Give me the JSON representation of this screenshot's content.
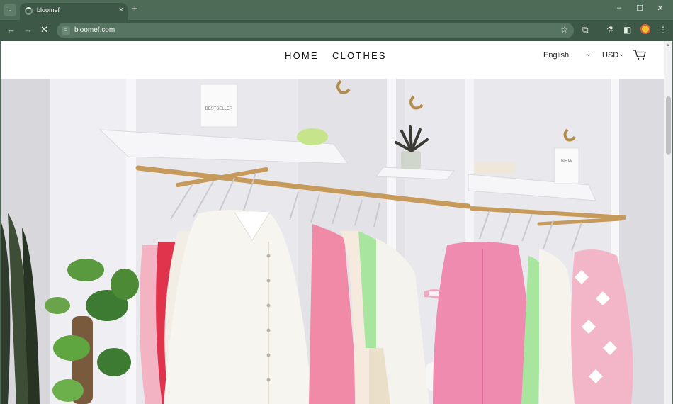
{
  "browser": {
    "tab_title": "bloomef",
    "tab_close": "×",
    "new_tab": "+",
    "url": "bloomef.com",
    "window_controls": {
      "minimize": "–",
      "maximize": "☐",
      "close": "✕"
    },
    "icons": [
      "tab-search-icon",
      "loading-spinner-icon",
      "back-icon",
      "forward-icon",
      "stop-icon",
      "site-info-icon",
      "bookmark-star-icon",
      "extensions-icon",
      "labs-icon",
      "side-panel-icon",
      "profile-avatar-icon",
      "kebab-menu-icon"
    ]
  },
  "site": {
    "nav": {
      "home": "HOME",
      "clothes": "CLOTHES"
    },
    "language": "English",
    "currency": "USD",
    "cart_icon": "cart-icon"
  },
  "hero": {
    "description_icon": "hero-image",
    "sign_1": "BESTSELLER",
    "sign_2": "NEW"
  },
  "colors": {
    "chrome": "#4e6b58",
    "toolbar": "#3e5848",
    "page_bg": "#ffffff"
  }
}
